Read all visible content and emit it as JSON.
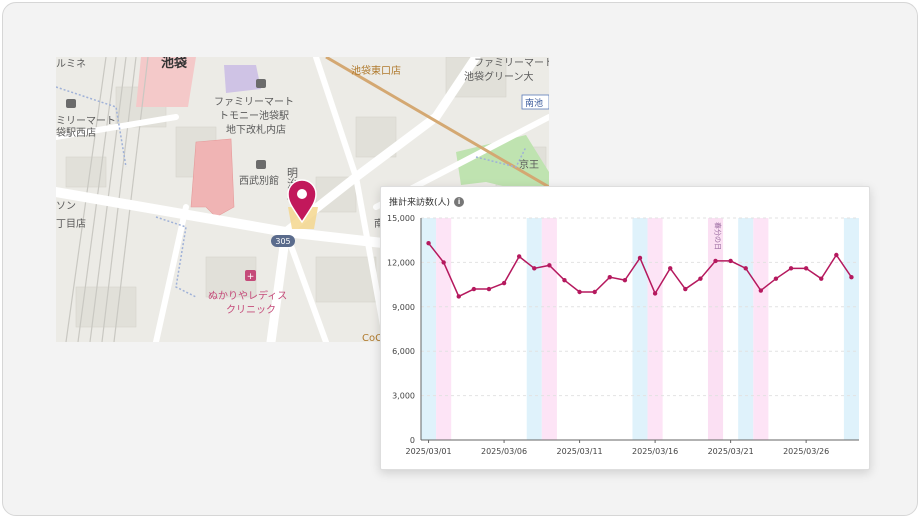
{
  "map": {
    "labels": {
      "ikebukuro": "池袋",
      "rumine": "ルミネ",
      "mart_east": "池袋東口店",
      "mart_green_1": "ファミリーマート",
      "mart_green_2": "池袋グリーン大",
      "minami_ike": "南池",
      "mart_west_1": "ミリーマート",
      "mart_west_2": "袋駅西店",
      "mart_station_1": "ファミリーマート",
      "mart_station_2": "トモニー池袋駅",
      "mart_station_3": "地下改札内店",
      "seibu": "西武別館",
      "meiji": "明治通",
      "keio": "京王",
      "lawson_1": "ソン",
      "lawson_2": "丁目店",
      "route": "305",
      "clinic_1": "ぬかりやレディス",
      "clinic_2": "クリニック",
      "coco": "CoC",
      "mina": "南"
    }
  },
  "panel": {
    "title": "推計来訪数(人)",
    "info_icon": "i"
  },
  "chart_data": {
    "type": "line",
    "ylabel": "推計来訪数(人)",
    "ylim": [
      0,
      15000
    ],
    "yticks": [
      0,
      3000,
      6000,
      9000,
      12000,
      15000
    ],
    "ytick_labels": [
      "0",
      "3,000",
      "6,000",
      "9,000",
      "12,000",
      "15,000"
    ],
    "x_dates": [
      "2025/03/01",
      "2025/03/02",
      "2025/03/03",
      "2025/03/04",
      "2025/03/05",
      "2025/03/06",
      "2025/03/07",
      "2025/03/08",
      "2025/03/09",
      "2025/03/10",
      "2025/03/11",
      "2025/03/12",
      "2025/03/13",
      "2025/03/14",
      "2025/03/15",
      "2025/03/16",
      "2025/03/17",
      "2025/03/18",
      "2025/03/19",
      "2025/03/20",
      "2025/03/21",
      "2025/03/22",
      "2025/03/23",
      "2025/03/24",
      "2025/03/25",
      "2025/03/26",
      "2025/03/27",
      "2025/03/28",
      "2025/03/29"
    ],
    "values": [
      13300,
      12000,
      9700,
      10200,
      10200,
      10600,
      12400,
      11600,
      11800,
      10800,
      10000,
      10000,
      11000,
      10800,
      12300,
      9900,
      11600,
      10200,
      10900,
      12100,
      12100,
      11600,
      10100,
      10900,
      11600,
      11600,
      10900,
      12500,
      11000
    ],
    "xtick_labels": [
      "2025/03/01",
      "2025/03/06",
      "2025/03/11",
      "2025/03/16",
      "2025/03/21",
      "2025/03/26"
    ],
    "xtick_dates": [
      "2025/03/01",
      "2025/03/06",
      "2025/03/11",
      "2025/03/16",
      "2025/03/21",
      "2025/03/26"
    ],
    "saturdays": [
      "2025/03/01",
      "2025/03/08",
      "2025/03/15",
      "2025/03/22",
      "2025/03/29"
    ],
    "sundays": [
      "2025/03/02",
      "2025/03/09",
      "2025/03/16",
      "2025/03/23"
    ],
    "holidays": [
      {
        "date": "2025/03/20",
        "label": "春分の日"
      }
    ],
    "colors": {
      "line": "#b5195e",
      "saturday": "#dff2fb",
      "sunday": "#fde4f6",
      "holiday": "#fbe0f3",
      "grid": "#e2e2e2",
      "axis": "#666666"
    },
    "grid": true
  }
}
